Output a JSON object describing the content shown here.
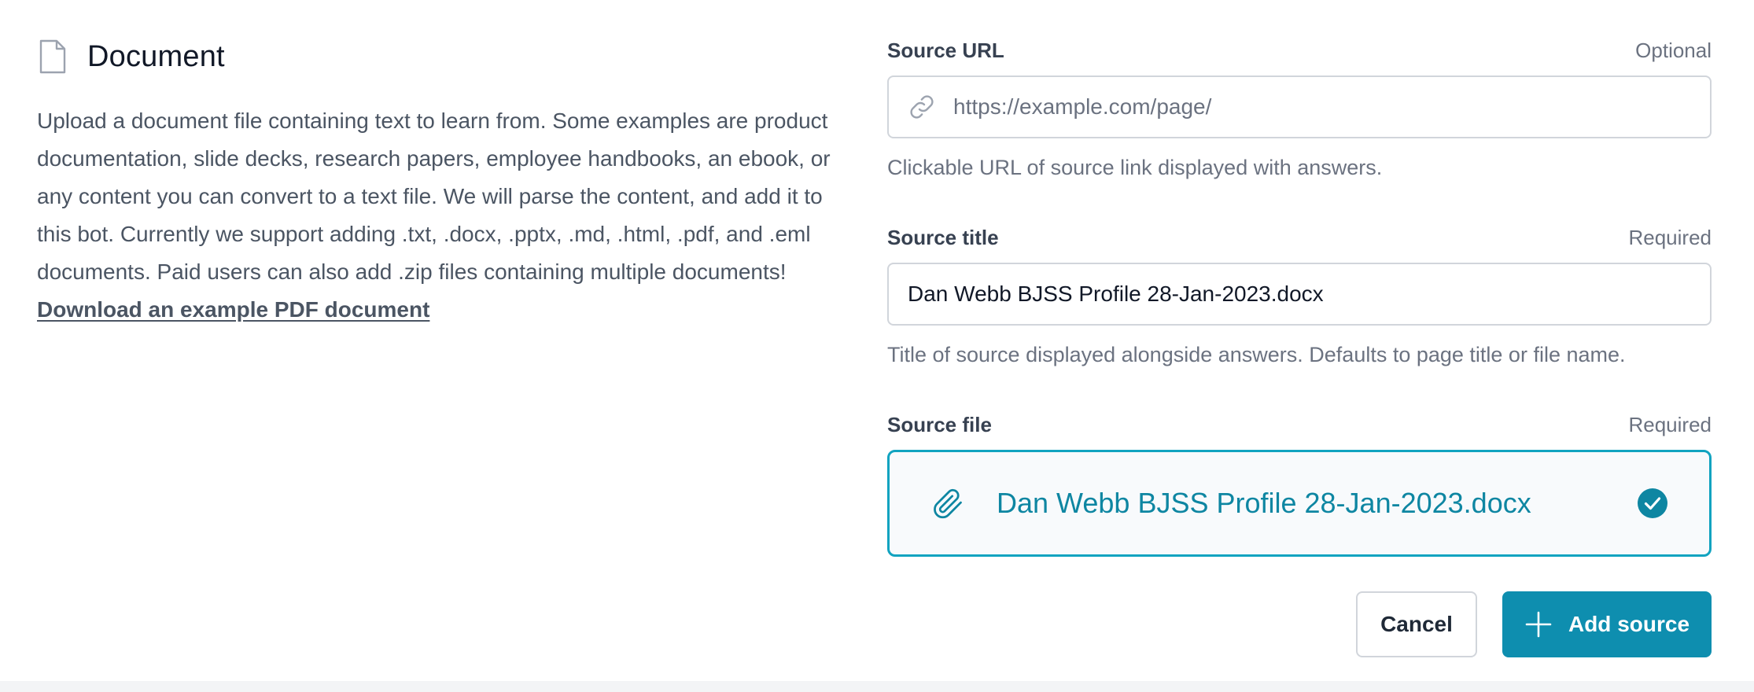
{
  "document": {
    "title": "Document",
    "icon": "document-icon",
    "description": "Upload a document file containing text to learn from. Some examples are product documentation, slide decks, research papers, employee handbooks, an ebook, or any content you can convert to a text file. We will parse the content, and add it to this bot. Currently we support adding .txt, .docx, .pptx, .md, .html, .pdf, and .eml documents. Paid users can also add .zip files containing multiple documents!",
    "download_link": "Download an example PDF document"
  },
  "source_url": {
    "label": "Source URL",
    "tag": "Optional",
    "placeholder": "https://example.com/page/",
    "value": "",
    "help": "Clickable URL of source link displayed with answers.",
    "icon": "link-icon"
  },
  "source_title": {
    "label": "Source title",
    "tag": "Required",
    "value": "Dan Webb BJSS Profile 28-Jan-2023.docx",
    "help": "Title of source displayed alongside answers. Defaults to page title or file name."
  },
  "source_file": {
    "label": "Source file",
    "tag": "Required",
    "file_name": "Dan Webb BJSS Profile 28-Jan-2023.docx",
    "icon": "paperclip-icon",
    "status_icon": "check-circle-icon"
  },
  "actions": {
    "cancel_label": "Cancel",
    "add_label": "Add source",
    "add_icon": "plus-icon"
  },
  "colors": {
    "accent": "#0e8eaf",
    "file_border": "#11a3c0",
    "file_text": "#0e86a2"
  }
}
